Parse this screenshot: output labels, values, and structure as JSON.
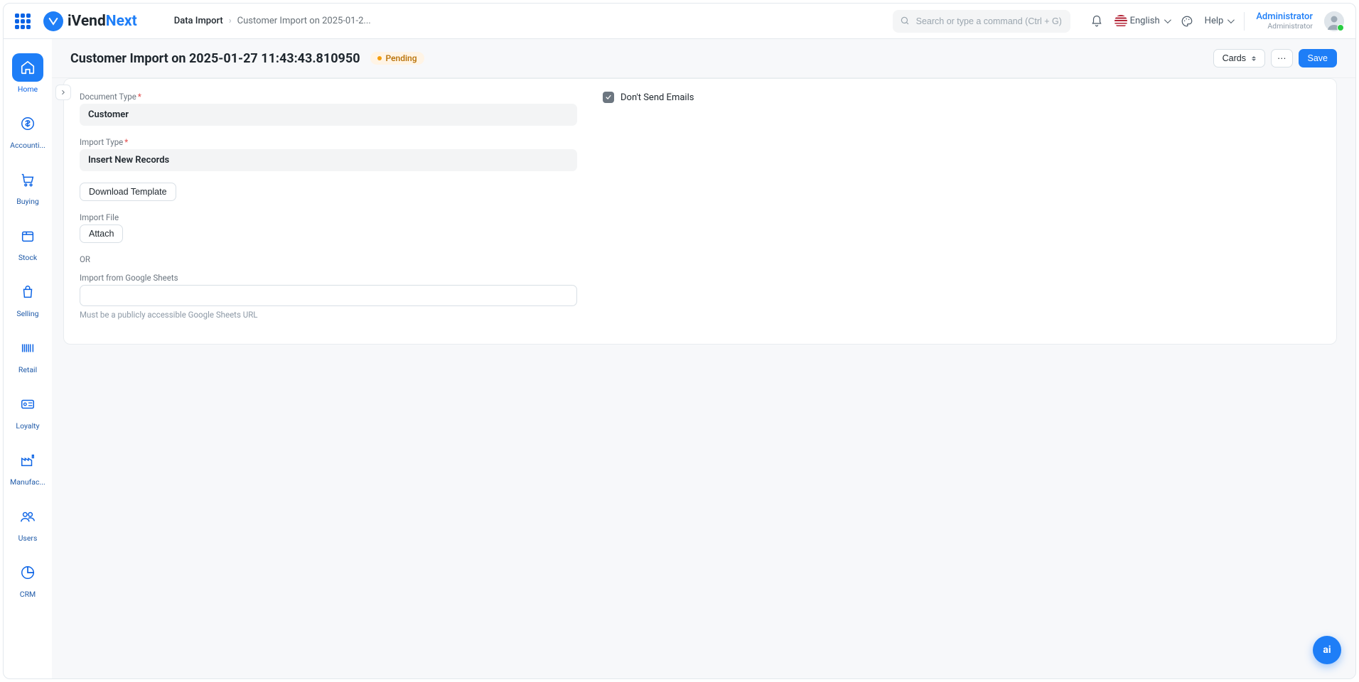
{
  "brand": {
    "name_part1": "iVend",
    "name_part2": "Next"
  },
  "breadcrumb": {
    "parent": "Data Import",
    "current": "Customer Import on 2025-01-2..."
  },
  "search": {
    "placeholder": "Search or type a command (Ctrl + G)"
  },
  "topnav": {
    "language": "English",
    "help": "Help"
  },
  "user": {
    "name": "Administrator",
    "role": "Administrator"
  },
  "sidebar": {
    "items": [
      {
        "label": "Home"
      },
      {
        "label": "Accounti..."
      },
      {
        "label": "Buying"
      },
      {
        "label": "Stock"
      },
      {
        "label": "Selling"
      },
      {
        "label": "Retail"
      },
      {
        "label": "Loyalty"
      },
      {
        "label": "Manufac..."
      },
      {
        "label": "Users"
      },
      {
        "label": "CRM"
      }
    ]
  },
  "page": {
    "title": "Customer Import on 2025-01-27 11:43:43.810950",
    "status": "Pending",
    "actions": {
      "cards": "Cards",
      "more": "···",
      "save": "Save"
    }
  },
  "form": {
    "document_type": {
      "label": "Document Type",
      "value": "Customer"
    },
    "import_type": {
      "label": "Import Type",
      "value": "Insert New Records"
    },
    "download_template": "Download Template",
    "import_file": {
      "label": "Import File",
      "attach": "Attach"
    },
    "or": "OR",
    "google_sheets": {
      "label": "Import from Google Sheets",
      "help": "Must be a publicly accessible Google Sheets URL"
    },
    "dont_send_emails": {
      "label": "Don't Send Emails",
      "checked": true
    }
  },
  "fab": "ai"
}
